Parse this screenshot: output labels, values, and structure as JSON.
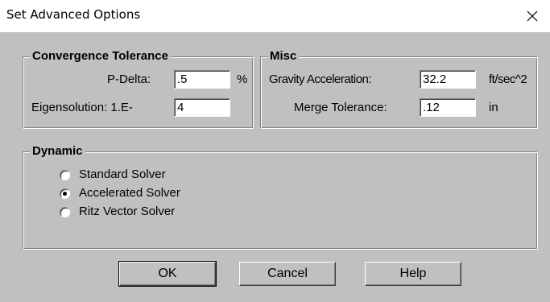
{
  "window": {
    "title": "Set Advanced Options"
  },
  "convergence": {
    "title": "Convergence Tolerance",
    "pdelta_label": "P-Delta:",
    "pdelta_value": ".5",
    "pdelta_unit": "%",
    "eigen_label": "Eigensolution: 1.E-",
    "eigen_value": "4"
  },
  "misc": {
    "title": "Misc",
    "gravity_label": "Gravity Acceleration:",
    "gravity_value": "32.2",
    "gravity_unit": "ft/sec^2",
    "merge_label": "Merge Tolerance:",
    "merge_value": ".12",
    "merge_unit": "in"
  },
  "dynamic": {
    "title": "Dynamic",
    "options": [
      {
        "label": "Standard Solver",
        "selected": false
      },
      {
        "label": "Accelerated Solver",
        "selected": true
      },
      {
        "label": "Ritz Vector Solver",
        "selected": false
      }
    ]
  },
  "buttons": {
    "ok": "OK",
    "cancel": "Cancel",
    "help": "Help"
  },
  "icons": {
    "close": "close-icon",
    "radio": "radio-button-icon"
  }
}
